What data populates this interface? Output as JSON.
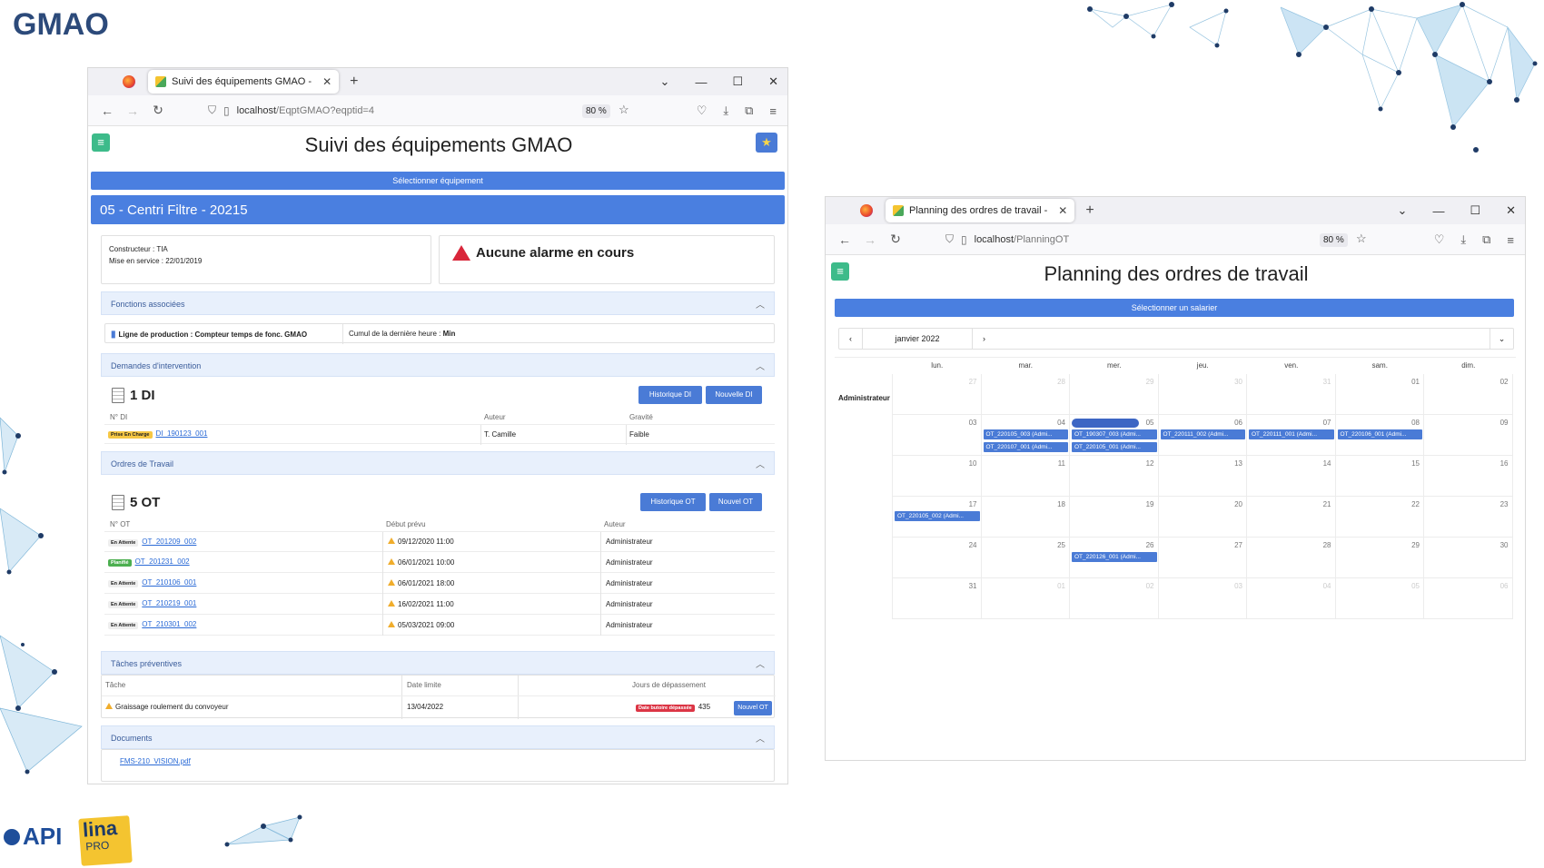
{
  "slide": {
    "title": "GMAO"
  },
  "logos": {
    "api": "API",
    "lina": "lina",
    "pro": "PRO"
  },
  "left_window": {
    "tab_title": "Suivi des équipements GMAO -",
    "url_host": "localhost",
    "url_path": "/EqptGMAO?eqptid=4",
    "zoom": "80 %",
    "app_title": "Suivi des équipements GMAO",
    "select_label": "Sélectionner équipement",
    "equipment_header": "05 - Centri Filtre - 20215",
    "constructor_line": "Constructeur : TIA",
    "service_line": "Mise en service : 22/01/2019",
    "alarm_text": "Aucune alarme en cours",
    "functions": {
      "header": "Fonctions associées",
      "item_label": "Ligne de production : Compteur temps de fonc. GMAO",
      "cumul_label": "Cumul de la dernière heure :",
      "cumul_value": "Min"
    },
    "di": {
      "header": "Demandes d'intervention",
      "count": "1 DI",
      "btn_history": "Historique DI",
      "btn_new": "Nouvelle DI",
      "col_num": "N° DI",
      "col_author": "Auteur",
      "col_gravity": "Gravité",
      "row": {
        "badge": "Prise En Charge",
        "num": "DI_190123_001",
        "author": "T. Camille",
        "gravity": "Faible"
      }
    },
    "ot": {
      "header": "Ordres de Travail",
      "count": "5 OT",
      "btn_history": "Historique OT",
      "btn_new": "Nouvel OT",
      "col_num": "N° OT",
      "col_start": "Début prévu",
      "col_author": "Auteur",
      "rows": [
        {
          "badge": "En Attente",
          "num": "OT_201209_002",
          "start": "09/12/2020 11:00",
          "author": "Administrateur"
        },
        {
          "badge": "Planifié",
          "num": "OT_201231_002",
          "start": "06/01/2021 10:00",
          "author": "Administrateur"
        },
        {
          "badge": "En Attente",
          "num": "OT_210106_001",
          "start": "06/01/2021 18:00",
          "author": "Administrateur"
        },
        {
          "badge": "En Attente",
          "num": "OT_210219_001",
          "start": "16/02/2021 11:00",
          "author": "Administrateur"
        },
        {
          "badge": "En Attente",
          "num": "OT_210301_002",
          "start": "05/03/2021 09:00",
          "author": "Administrateur"
        }
      ]
    },
    "preventive": {
      "header": "Tâches préventives",
      "col_task": "Tâche",
      "col_limit": "Date limite",
      "col_overdue": "Jours de dépassement",
      "task": "Graissage roulement du convoyeur",
      "limit": "13/04/2022",
      "badge": "Date butoire dépassée",
      "days": "435",
      "btn_new": "Nouvel OT"
    },
    "documents": {
      "header": "Documents",
      "file": "FMS-210_VISION.pdf"
    }
  },
  "right_window": {
    "tab_title": "Planning des ordres de travail -",
    "url_host": "localhost",
    "url_path": "/PlanningOT",
    "zoom": "80 %",
    "app_title": "Planning des ordres de travail",
    "select_label": "Sélectionner un salarier",
    "month": "janvier 2022",
    "row_label": "Administrateur",
    "weekdays": [
      "lun.",
      "mar.",
      "mer.",
      "jeu.",
      "ven.",
      "sam.",
      "dim."
    ],
    "weeks": [
      [
        {
          "d": "27",
          "out": true
        },
        {
          "d": "28",
          "out": true
        },
        {
          "d": "29",
          "out": true
        },
        {
          "d": "30",
          "out": true
        },
        {
          "d": "31",
          "out": true
        },
        {
          "d": "01",
          "out": false
        },
        {
          "d": "02",
          "out": false
        }
      ],
      [
        {
          "d": "03",
          "out": false
        },
        {
          "d": "04",
          "out": false
        },
        {
          "d": "05",
          "out": false
        },
        {
          "d": "06",
          "out": false
        },
        {
          "d": "07",
          "out": false
        },
        {
          "d": "08",
          "out": false
        },
        {
          "d": "09",
          "out": false
        }
      ],
      [
        {
          "d": "10",
          "out": false
        },
        {
          "d": "11",
          "out": false
        },
        {
          "d": "12",
          "out": false
        },
        {
          "d": "13",
          "out": false
        },
        {
          "d": "14",
          "out": false
        },
        {
          "d": "15",
          "out": false
        },
        {
          "d": "16",
          "out": false
        }
      ],
      [
        {
          "d": "17",
          "out": false
        },
        {
          "d": "18",
          "out": false
        },
        {
          "d": "19",
          "out": false
        },
        {
          "d": "20",
          "out": false
        },
        {
          "d": "21",
          "out": false
        },
        {
          "d": "22",
          "out": false
        },
        {
          "d": "23",
          "out": false
        }
      ],
      [
        {
          "d": "24",
          "out": false
        },
        {
          "d": "25",
          "out": false
        },
        {
          "d": "26",
          "out": false
        },
        {
          "d": "27",
          "out": false
        },
        {
          "d": "28",
          "out": false
        },
        {
          "d": "29",
          "out": false
        },
        {
          "d": "30",
          "out": false
        }
      ],
      [
        {
          "d": "31",
          "out": false
        },
        {
          "d": "01",
          "out": true
        },
        {
          "d": "02",
          "out": true
        },
        {
          "d": "03",
          "out": true
        },
        {
          "d": "04",
          "out": true
        },
        {
          "d": "05",
          "out": true
        },
        {
          "d": "06",
          "out": true
        }
      ]
    ],
    "events": [
      {
        "week": 1,
        "day": 1,
        "slot": 0,
        "label": "OT_220105_003 (Admi..."
      },
      {
        "week": 1,
        "day": 1,
        "slot": 1,
        "label": "OT_220107_001 (Admi..."
      },
      {
        "week": 1,
        "day": 2,
        "slot": 0,
        "label": "OT_190307_003 (Admi..."
      },
      {
        "week": 1,
        "day": 2,
        "slot": 1,
        "label": "OT_220105_001 (Admi..."
      },
      {
        "week": 1,
        "day": 3,
        "slot": 0,
        "label": "OT_220111_002 (Admi..."
      },
      {
        "week": 1,
        "day": 4,
        "slot": 0,
        "label": "OT_220111_001 (Admi..."
      },
      {
        "week": 1,
        "day": 5,
        "slot": 0,
        "label": "OT_220106_001 (Admi..."
      },
      {
        "week": 3,
        "day": 0,
        "slot": 0,
        "label": "OT_220105_002 (Admi..."
      },
      {
        "week": 4,
        "day": 2,
        "slot": 0,
        "label": "OT_220126_001 (Admi..."
      }
    ]
  }
}
